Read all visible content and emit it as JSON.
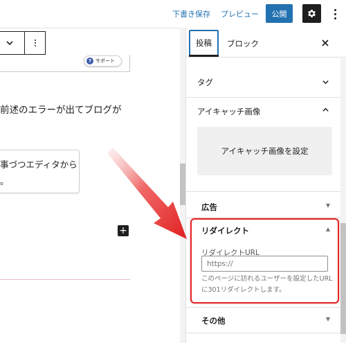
{
  "header": {
    "save_draft": "下書き保存",
    "preview": "プレビュー",
    "publish": "公開",
    "settings_icon": "gear-icon",
    "more_icon": "more-vertical-icon"
  },
  "editor": {
    "support_badge": "サポート",
    "support_badge_icon": "question-icon",
    "paragraph": "前述のエラーが出てブログが",
    "quote_line1": "事づつエディタから",
    "quote_line2": "。",
    "inserter_symbol": "+"
  },
  "sidebar": {
    "tabs": [
      {
        "label": "投稿",
        "active": true
      },
      {
        "label": "ブロック",
        "active": false
      }
    ],
    "close_symbol": "✕",
    "panels": {
      "tags": {
        "title": "タグ",
        "expanded": false
      },
      "featured_image": {
        "title": "アイキャッチ画像",
        "expanded": true,
        "set_button": "アイキャッチ画像を設定"
      },
      "ads": {
        "title": "広告",
        "expanded": false
      },
      "redirect": {
        "title": "リダイレクト",
        "expanded": true,
        "url_label": "リダイレクトURL",
        "url_placeholder": "https://",
        "help": "このページに訪れるユーザーを設定したURLに301リダイレクトします。"
      },
      "other": {
        "title": "その他",
        "expanded": false
      }
    }
  },
  "colors": {
    "accent": "#2271b1",
    "highlight": "#e32424",
    "arrow": "#e32424",
    "dark": "#1e1e1e"
  }
}
